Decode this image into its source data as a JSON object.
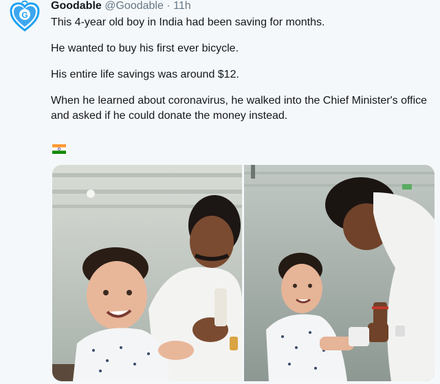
{
  "account": {
    "display_name": "Goodable",
    "handle": "@Goodable",
    "separator": "·",
    "time": "11h",
    "avatar_letter": "G",
    "avatar_icon": "heart-logo-icon",
    "brand_color": "#1da1f2"
  },
  "tweet": {
    "lines": [
      "This 4-year old boy in India had been saving for months.",
      "He wanted to buy his first ever bicycle.",
      "His entire life savings was around $12.",
      "When he learned about coronavirus, he walked into the Chief Minister's office and asked if he could donate the money instead."
    ],
    "emoji": "india-flag-icon"
  },
  "media": {
    "photos": [
      {
        "description": "boy-and-minister-seated",
        "icon": "photo"
      },
      {
        "description": "boy-handing-money-to-minister",
        "icon": "photo"
      }
    ]
  }
}
